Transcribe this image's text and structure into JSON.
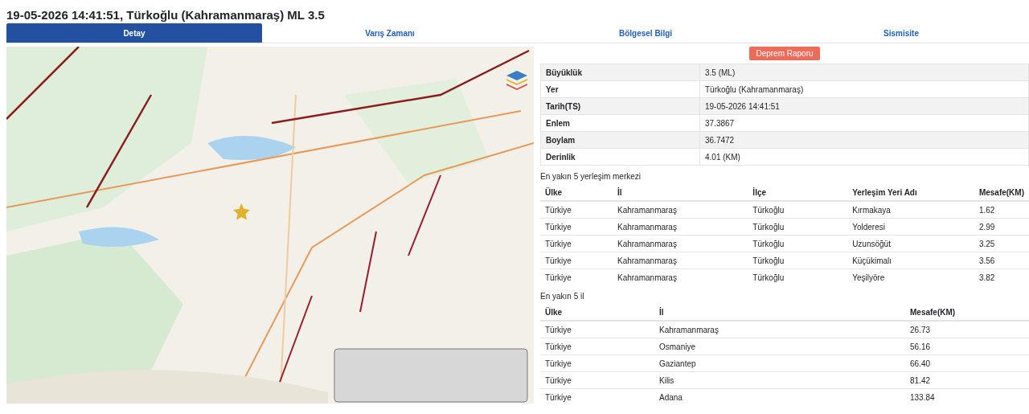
{
  "title": "19-05-2026 14:41:51, Türkoğlu (Kahramanmaraş) ML 3.5",
  "tabs": [
    {
      "label": "Detay",
      "selected": true
    },
    {
      "label": "Varış Zamanı",
      "selected": false
    },
    {
      "label": "Bölgesel Bilgi",
      "selected": false
    },
    {
      "label": "Sismisite",
      "selected": false
    }
  ],
  "map": {
    "kind": "picture"
  },
  "report_button": "Deprem Raporu",
  "details": [
    [
      "Büyüklük",
      "3.5 (ML)"
    ],
    [
      "Yer",
      "Türkoğlu (Kahramanmaraş)"
    ],
    [
      "Tarih(TS)",
      "19-05-2026 14:41:51"
    ],
    [
      "Enlem",
      "37.3867"
    ],
    [
      "Boylam",
      "36.7472"
    ],
    [
      "Derinlik",
      "4.01 (KM)"
    ]
  ],
  "settlements": {
    "caption": "En yakın 5 yerleşim merkezi",
    "columns": [
      "Ülke",
      "İl",
      "İlçe",
      "Yerleşim Yeri Adı",
      "Mesafe(KM)"
    ],
    "rows": [
      [
        "Türkiye",
        "Kahramanmaraş",
        "Türkoğlu",
        "Kırmakaya",
        "1.62"
      ],
      [
        "Türkiye",
        "Kahramanmaraş",
        "Türkoğlu",
        "Yolderesi",
        "2.99"
      ],
      [
        "Türkiye",
        "Kahramanmaraş",
        "Türkoğlu",
        "Uzunsöğüt",
        "3.25"
      ],
      [
        "Türkiye",
        "Kahramanmaraş",
        "Türkoğlu",
        "Küçükimalı",
        "3.56"
      ],
      [
        "Türkiye",
        "Kahramanmaraş",
        "Türkoğlu",
        "Yeşilyöre",
        "3.82"
      ]
    ]
  },
  "provinces": {
    "caption": "En yakın 5 il",
    "columns": [
      "Ülke",
      "İl",
      "Mesafe(KM)"
    ],
    "rows": [
      [
        "Türkiye",
        "Kahramanmaraş",
        "26.73"
      ],
      [
        "Türkiye",
        "Osmaniye",
        "56.16"
      ],
      [
        "Türkiye",
        "Gaziantep",
        "66.40"
      ],
      [
        "Türkiye",
        "Kilis",
        "81.42"
      ],
      [
        "Türkiye",
        "Adana",
        "133.84"
      ]
    ]
  }
}
